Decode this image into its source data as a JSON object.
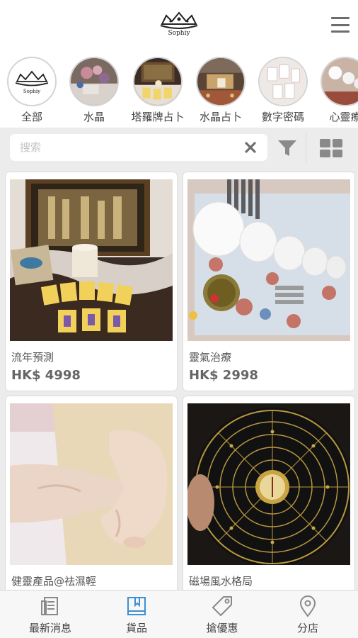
{
  "header": {
    "logo_text": "Sophiy"
  },
  "categories": [
    {
      "label": "全部"
    },
    {
      "label": "水晶"
    },
    {
      "label": "塔羅牌占卜"
    },
    {
      "label": "水晶占卜"
    },
    {
      "label": "數字密碼"
    },
    {
      "label": "心靈療"
    }
  ],
  "search": {
    "placeholder": "搜索",
    "value": ""
  },
  "products": [
    {
      "title": "流年預測",
      "price": "HK$ 4998"
    },
    {
      "title": "靈氣治療",
      "price": "HK$ 2998"
    },
    {
      "title": "健靈產品@祛濕輕",
      "price": ""
    },
    {
      "title": "磁場風水格局",
      "price": ""
    }
  ],
  "tabbar": {
    "items": [
      {
        "label": "最新消息",
        "icon": "news-icon"
      },
      {
        "label": "貨品",
        "icon": "book-icon"
      },
      {
        "label": "搶優惠",
        "icon": "tag-icon"
      },
      {
        "label": "分店",
        "icon": "location-pin-icon"
      }
    ],
    "active_index": 1,
    "active_color": "#3d8fd1"
  },
  "colors": {
    "background_band": "#ececec",
    "icon_gray": "#8a8a8a"
  }
}
